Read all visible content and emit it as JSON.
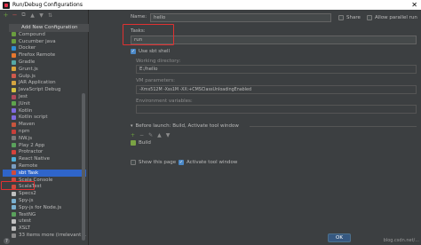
{
  "window": {
    "title": "Run/Debug Configurations",
    "close": "✕"
  },
  "toolbar": {
    "add": "+",
    "remove": "−",
    "copy": "⧉",
    "up": "▲",
    "down": "▼",
    "sort": "⇅"
  },
  "popup": {
    "title": "Add New Configuration"
  },
  "list": [
    {
      "label": "Compound",
      "color": "#6a9e3f"
    },
    {
      "label": "Cucumber java",
      "color": "#6a9e3f"
    },
    {
      "label": "Docker",
      "color": "#2f8ed4"
    },
    {
      "label": "Firefox Remote",
      "color": "#e8772e"
    },
    {
      "label": "Gradle",
      "color": "#55a8a6"
    },
    {
      "label": "Grunt.js",
      "color": "#d9a43b"
    },
    {
      "label": "Gulp.js",
      "color": "#d05a4c"
    },
    {
      "label": "JAR Application",
      "color": "#d4a441"
    },
    {
      "label": "JavaScript Debug",
      "color": "#d4c040"
    },
    {
      "label": "Jest",
      "color": "#b0485a"
    },
    {
      "label": "JUnit",
      "color": "#5ea44d"
    },
    {
      "label": "Kotlin",
      "color": "#7f6ae0"
    },
    {
      "label": "Kotlin script",
      "color": "#7f6ae0"
    },
    {
      "label": "Maven",
      "color": "#c8553d"
    },
    {
      "label": "npm",
      "color": "#c8403a"
    },
    {
      "label": "NW.js",
      "color": "#7a7a7a"
    },
    {
      "label": "Play 2 App",
      "color": "#5aa25c"
    },
    {
      "label": "Protractor",
      "color": "#d5433b"
    },
    {
      "label": "React Native",
      "color": "#4fb0d8"
    },
    {
      "label": "Remote",
      "color": "#7a9ec2"
    },
    {
      "label": "sbt Task",
      "color": "#d04b3c"
    },
    {
      "label": "Scala Console",
      "color": "#d04b3c"
    },
    {
      "label": "ScalaTest",
      "color": "#d04b3c"
    },
    {
      "label": "Specs2",
      "color": "#c0c0c0"
    },
    {
      "label": "Spy-js",
      "color": "#7ab0d0"
    },
    {
      "label": "Spy-js for Node.js",
      "color": "#7ab0d0"
    },
    {
      "label": "TestNG",
      "color": "#5aa25c"
    },
    {
      "label": "utest",
      "color": "#c0c0c0"
    },
    {
      "label": "XSLT",
      "color": "#c0c0c0"
    },
    {
      "label": "33 items more (irrelevant)...",
      "color": "#8c8c8c"
    }
  ],
  "form": {
    "name_label": "Name:",
    "name_value": "hello",
    "share_label": "Share",
    "parallel_label": "Allow parallel run",
    "tasks_label": "Tasks:",
    "tasks_value": "run",
    "use_sbt_label": "Use sbt shell",
    "workdir_label": "Working directory:",
    "workdir_value": "E:/hello",
    "vmparams_label": "VM parameters:",
    "vmparams_value": "-Xmx512M -Xss1M -XX:+CMSClassUnloadingEnabled",
    "envvars_label": "Environment variables:",
    "before_launch_label": "Before launch: Build, Activate tool window",
    "build_item": "Build",
    "show_page_label": "Show this page",
    "activate_tool_label": "Activate tool window"
  },
  "buttons": {
    "ok": "OK"
  },
  "watermark": "blog.csdn.net/..."
}
